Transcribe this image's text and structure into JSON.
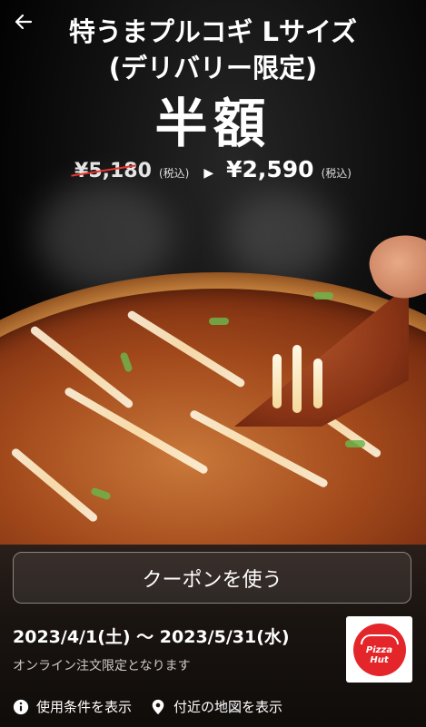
{
  "header": {
    "title_line1": "特うまプルコギ Lサイズ",
    "title_line2": "(デリバリー限定)",
    "discount": "半額"
  },
  "price": {
    "old": "¥5,180",
    "old_tax": "(税込)",
    "new": "¥2,590",
    "new_tax": "(税込)"
  },
  "coupon": {
    "button_label": "クーポンを使う",
    "period": "2023/4/1(土) 〜 2023/5/31(水)",
    "note": "オンライン注文限定となります"
  },
  "brand": {
    "logo_text_1": "Pizza",
    "logo_text_2": "Hut",
    "logo_color": "#e4262a"
  },
  "links": {
    "terms": "使用条件を表示",
    "map": "付近の地図を表示"
  },
  "icons": [
    "back-arrow-icon",
    "info-icon",
    "map-pin-icon",
    "pizza-hut-logo"
  ]
}
